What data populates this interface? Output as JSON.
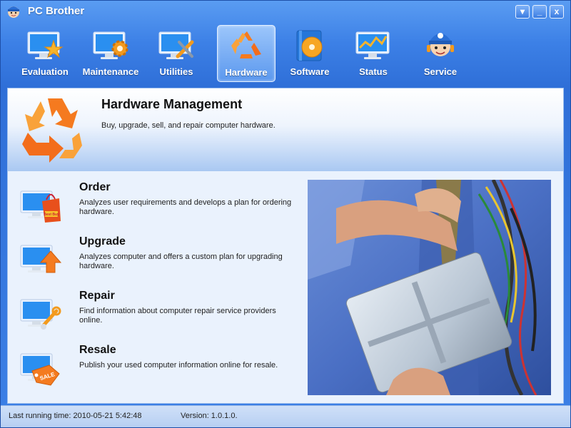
{
  "window": {
    "title": "PC Brother",
    "menu_symbol": "▾",
    "minimize_symbol": "_",
    "close_symbol": "x"
  },
  "toolbar": {
    "items": [
      {
        "label": "Evaluation",
        "icon": "monitor-star-icon",
        "active": false
      },
      {
        "label": "Maintenance",
        "icon": "monitor-gear-icon",
        "active": false
      },
      {
        "label": "Utilities",
        "icon": "monitor-tools-icon",
        "active": false
      },
      {
        "label": "Hardware",
        "icon": "recycle-icon",
        "active": true
      },
      {
        "label": "Software",
        "icon": "software-disc-icon",
        "active": false
      },
      {
        "label": "Status",
        "icon": "monitor-chart-icon",
        "active": false
      },
      {
        "label": "Service",
        "icon": "service-mascot-icon",
        "active": false
      }
    ]
  },
  "header": {
    "title": "Hardware Management",
    "description": "Buy, upgrade, sell, and repair computer hardware."
  },
  "items": [
    {
      "title": "Order",
      "description": "Analyzes user requirements and develops a plan for ordering hardware.",
      "icon": "order-bag-icon",
      "badge": "Best Buy"
    },
    {
      "title": "Upgrade",
      "description": "Analyzes computer and offers a custom plan for upgrading hardware.",
      "icon": "upgrade-arrow-icon"
    },
    {
      "title": "Repair",
      "description": "Find information about computer repair service providers online.",
      "icon": "repair-wrench-icon"
    },
    {
      "title": "Resale",
      "description": "Publish your used computer information online for resale.",
      "icon": "resale-tag-icon",
      "badge": "SALE"
    }
  ],
  "status": {
    "last_running": "Last running time: 2010-05-21 5:42:48",
    "version": "Version: 1.0.1.0."
  },
  "colors": {
    "window_blue": "#3c80e6",
    "accent_orange": "#f47b20",
    "content_bg": "#eaf2fd"
  }
}
